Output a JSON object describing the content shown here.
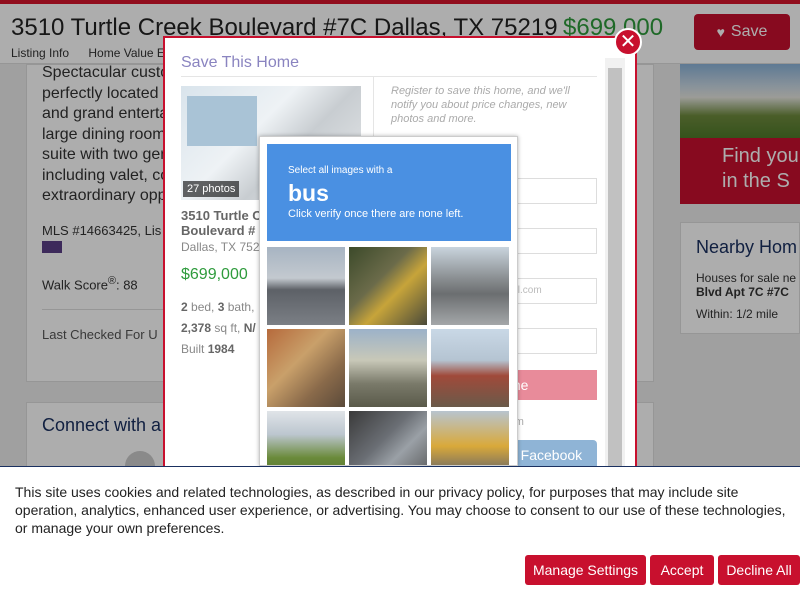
{
  "header": {
    "address": "3510 Turtle Creek Boulevard #7C Dallas, TX 75219",
    "price": "$699,000",
    "save_label": "Save",
    "subnav": [
      "Listing Info",
      "Home Value E"
    ]
  },
  "listing": {
    "description": "Spectacular custo… perfectly located and grand enterta… large dining room suite with two ge… including valet, co… extraordinary opp…",
    "description_lines": [
      "Spectacular custo",
      "perfectly located",
      "and grand entertai",
      "large dining room",
      "suite with two ger",
      "including valet, co",
      "extraordinary opp"
    ],
    "mls": "MLS #14663425, Lis",
    "walk_score_label": "Walk Score",
    "walk_score_sup": "®",
    "walk_score_value": ": 88",
    "last_checked": "Last Checked For U"
  },
  "connect": {
    "title": "Connect with a"
  },
  "sidebar": {
    "ad_text_line1": "Find you",
    "ad_text_line2": "in the S",
    "nearby_title": "Nearby Hom",
    "nearby_line1": "Houses for sale ne",
    "nearby_line2": "Blvd Apt 7C #7C",
    "nearby_within_label": "Within:",
    "nearby_within_value": "1/2 mile"
  },
  "modal": {
    "title": "Save This Home",
    "photos_count": "27 photos",
    "address_line1": "3510 Turtle C",
    "address_line2": "Boulevard #",
    "city": "Dallas, TX 752",
    "price": "$699,000",
    "beds_num": "2",
    "beds_label": " bed, ",
    "baths_num": "3",
    "baths_label": " bath,",
    "sqft_num": "2,378",
    "sqft_label": " sq ft, ",
    "sqft_na": "N/",
    "built_label": "Built ",
    "built_year": "1984",
    "register_text": "Register to save this home, and we'll notify you about price changes, new photos and more.",
    "email_hint": "ail.com",
    "submit_label": "me",
    "or_label": "orm",
    "facebook_label": "n Facebook",
    "close_symbol": "✕"
  },
  "captcha": {
    "instruction": "Select all images with a",
    "target": "bus",
    "hint": "Click verify once there are none left."
  },
  "cookie": {
    "text": "This site uses cookies and related technologies, as described in our privacy policy, for purposes that may include site operation, analytics, enhanced user experience, or advertising. You may choose to consent to our use of these technologies, or manage your own preferences.",
    "manage_label": "Manage Settings",
    "accept_label": "Accept",
    "decline_label": "Decline All"
  },
  "colors": {
    "brand_red": "#c8102e",
    "price_green": "#2e9b3c",
    "navy": "#1a3060",
    "captcha_blue": "#4a90e2"
  }
}
